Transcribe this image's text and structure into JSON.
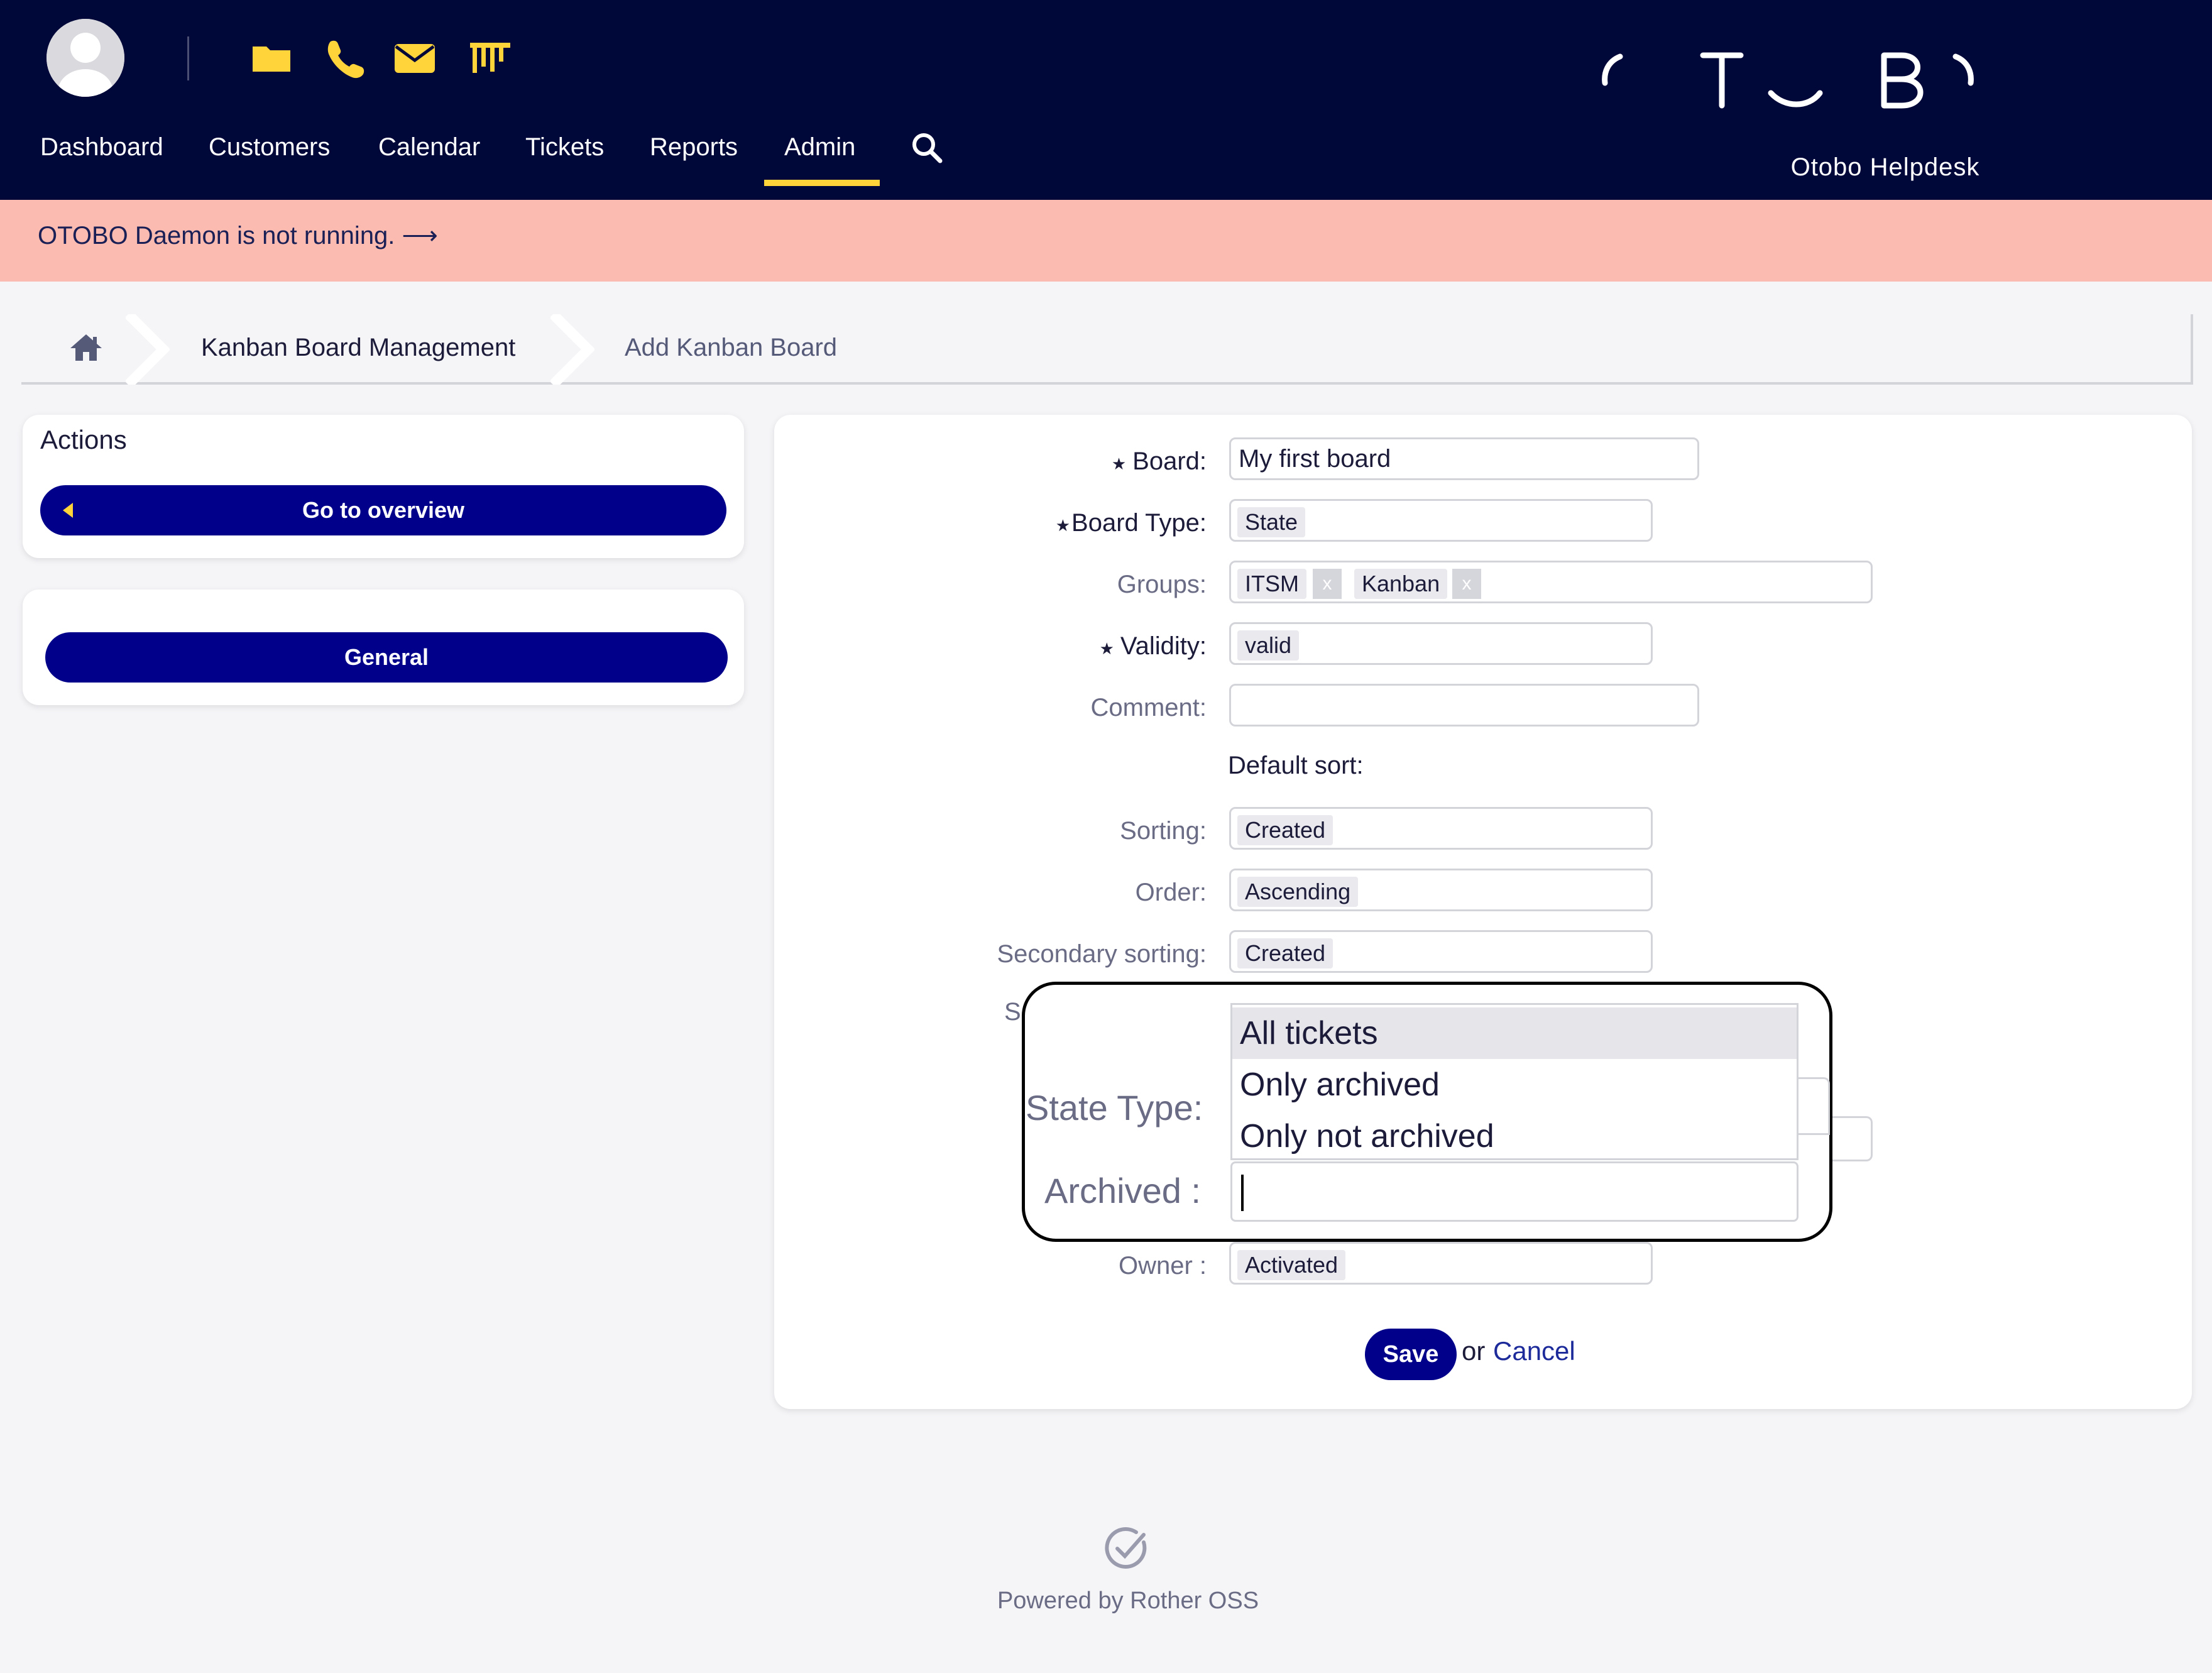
{
  "header": {
    "nav": [
      "Dashboard",
      "Customers",
      "Calendar",
      "Tickets",
      "Reports",
      "Admin"
    ],
    "active_nav": "Admin",
    "quick_icons": [
      "folder-icon",
      "phone-icon",
      "envelope-icon",
      "kanban-icon"
    ],
    "logo_text": "Otobo Helpdesk",
    "colors": {
      "bar": "#000839",
      "accent": "#ffd43b"
    }
  },
  "banner": {
    "text": "OTOBO Daemon is not running. ⟶",
    "color": "#fbbbb0"
  },
  "breadcrumb": [
    "Kanban Board Management",
    "Add Kanban Board"
  ],
  "sidebar": {
    "actions_title": "Actions",
    "overview_button": "Go to overview",
    "general_button": "General"
  },
  "form": {
    "board_label": "Board:",
    "board_value": "My first board",
    "board_type_label": "Board Type:",
    "board_type_value": "State",
    "groups_label": "Groups:",
    "groups": [
      "ITSM",
      "Kanban"
    ],
    "chip_remove": "x",
    "validity_label": "Validity:",
    "validity_value": "valid",
    "comment_label": "Comment:",
    "comment_value": "",
    "default_sort": "Default sort:",
    "sorting_label": "Sorting:",
    "sorting_value": "Created",
    "order_label": "Order:",
    "order_value": "Ascending",
    "secondary_sorting_label": "Secondary sorting:",
    "secondary_sorting_value": "Created",
    "partial_label": "S",
    "state_type_label": "State Type:",
    "archived_label": "Archived :",
    "archived_options": [
      "All tickets",
      "Only archived",
      "Only not archived"
    ],
    "archived_highlighted": "All tickets",
    "owner_label": "Owner :",
    "owner_value": "Activated",
    "required_star": "★"
  },
  "buttons": {
    "save": "Save",
    "or": "or",
    "cancel": "Cancel"
  },
  "footer": {
    "text": "Powered by Rother OSS"
  }
}
